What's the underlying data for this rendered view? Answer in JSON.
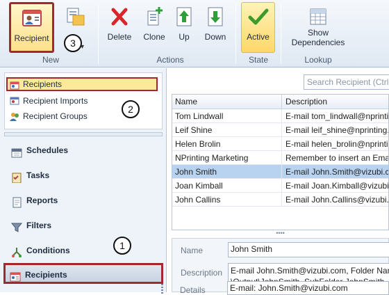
{
  "ribbon": {
    "recipient": "Recipient",
    "delete": "Delete",
    "clone": "Clone",
    "up": "Up",
    "down": "Down",
    "active": "Active",
    "show_dependencies_1": "Show",
    "show_dependencies_2": "Dependencies",
    "groups": {
      "new": "New",
      "actions": "Actions",
      "state": "State",
      "lookup": "Lookup"
    }
  },
  "callouts": {
    "one": "1",
    "two": "2",
    "three": "3"
  },
  "nav": {
    "sub_items": [
      "Recipients",
      "Recipient Imports",
      "Recipient Groups"
    ],
    "main_items": [
      "Schedules",
      "Tasks",
      "Reports",
      "Filters",
      "Conditions",
      "Recipients"
    ]
  },
  "search": {
    "placeholder": "Search Recipient (Ctrl-E)"
  },
  "grid": {
    "columns": [
      "Name",
      "Description"
    ],
    "rows": [
      [
        "Tom Lindwall",
        "E-mail tom_lindwall@nprinting.com"
      ],
      [
        "Leif Shine",
        "E-mail leif_shine@nprinting.com"
      ],
      [
        "Helen Brolin",
        "E-mail helen_brolin@nprinting.com"
      ],
      [
        "NPrinting Marketing",
        "Remember to insert an Email"
      ],
      [
        "John Smith",
        "E-mail John.Smith@vizubi.com"
      ],
      [
        "Joan Kimball",
        "E-mail Joan.Kimball@vizubi.com"
      ],
      [
        "John Callins",
        "E-mail John.Callins@vizubi.com"
      ]
    ],
    "selected_index": 4
  },
  "detail": {
    "name_label": "Name",
    "name_value": "John Smith",
    "desc_label": "Description",
    "desc_line1": "E-mail John.Smith@vizubi.com, Folder Name",
    "desc_line2": "\\Output\\JohnSmith, SubFolder JohnSmith",
    "details_label": "Details",
    "details_value": "E-mail: John.Smith@vizubi.com"
  },
  "colors": {
    "highlight_red": "#a32730",
    "selected_row": "#b8d3f0",
    "active_yellow": "#ffd768"
  }
}
